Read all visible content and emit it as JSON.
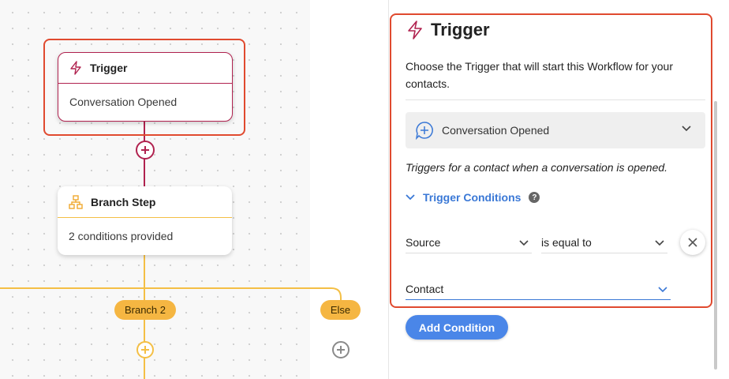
{
  "canvas": {
    "trigger_node": {
      "title": "Trigger",
      "subtitle": "Conversation Opened"
    },
    "branch_node": {
      "title": "Branch Step",
      "subtitle": "2 conditions provided"
    },
    "branch_labels": {
      "branch2": "Branch 2",
      "else": "Else"
    }
  },
  "panel": {
    "title": "Trigger",
    "description": "Choose the Trigger that will start this Workflow for your contacts.",
    "trigger_select": {
      "value": "Conversation Opened"
    },
    "trigger_note": "Triggers for a contact when a conversation is opened.",
    "conditions_toggle": "Trigger Conditions",
    "help_glyph": "?",
    "condition": {
      "field": "Source",
      "operator": "is equal to",
      "value": "Contact"
    },
    "add_condition": "Add Condition"
  },
  "colors": {
    "trigger": "#b0224f",
    "branch": "#f4bf45",
    "accent": "#4a86e8",
    "highlight": "#e04a2f"
  },
  "icons": [
    "bolt-icon",
    "branch-icon",
    "chat-plus-icon",
    "chevron-down-icon",
    "help-icon",
    "close-icon",
    "add-node-icon"
  ]
}
